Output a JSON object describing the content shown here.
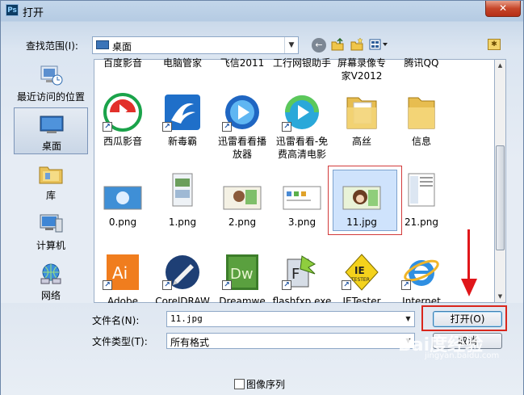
{
  "window": {
    "title": "打开",
    "app_icon": "Ps",
    "close_label": "✕"
  },
  "lookin": {
    "label": "查找范围(I):",
    "value": "桌面"
  },
  "places": [
    {
      "label": "最近访问的位置",
      "icon": "recent-places-icon"
    },
    {
      "label": "桌面",
      "icon": "desktop-icon",
      "selected": true
    },
    {
      "label": "库",
      "icon": "libraries-icon"
    },
    {
      "label": "计算机",
      "icon": "computer-icon"
    },
    {
      "label": "网络",
      "icon": "network-icon"
    }
  ],
  "files": [
    {
      "name": "百度影音"
    },
    {
      "name": "电脑管家"
    },
    {
      "name": "飞信2011"
    },
    {
      "name": "工行网银助手"
    },
    {
      "name": "屏幕录像专家V2012"
    },
    {
      "name": "腾讯QQ"
    },
    {
      "name": "西瓜影音"
    },
    {
      "name": "新毒霸"
    },
    {
      "name": "迅雷看看播放器"
    },
    {
      "name": "迅雷看看-免费高清电影"
    },
    {
      "name": "高丝"
    },
    {
      "name": "信息"
    },
    {
      "name": "0.png"
    },
    {
      "name": "1.png"
    },
    {
      "name": "2.png"
    },
    {
      "name": "3.png"
    },
    {
      "name": "11.jpg",
      "selected": true
    },
    {
      "name": "21.png"
    },
    {
      "name": "Adobe"
    },
    {
      "name": "CorelDRAW"
    },
    {
      "name": "Dreamwe"
    },
    {
      "name": "flashfxp.exe"
    },
    {
      "name": "IETester"
    },
    {
      "name": "Internet"
    }
  ],
  "filename": {
    "label": "文件名(N):",
    "value": "11.jpg"
  },
  "filetype": {
    "label": "文件类型(T):",
    "value": "所有格式"
  },
  "buttons": {
    "open": "打开(O)",
    "cancel": "取消"
  },
  "image_sequence": {
    "label": "图像序列",
    "checked": false
  },
  "watermark": {
    "text": "Bai度经验",
    "sub": "jingyan.baidu.com"
  }
}
